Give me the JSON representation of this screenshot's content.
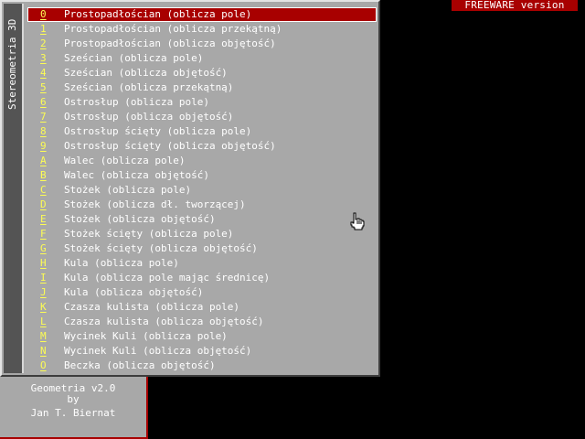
{
  "banner": {
    "text": "FREEWARE version"
  },
  "menu": {
    "title": "Stereometria 3D",
    "selected_index": 0,
    "items": [
      {
        "key": "0",
        "label": "Prostopadłościan (oblicza pole)"
      },
      {
        "key": "1",
        "label": "Prostopadłościan (oblicza przekątną)"
      },
      {
        "key": "2",
        "label": "Prostopadłościan (oblicza objętość)"
      },
      {
        "key": "3",
        "label": "Sześcian (oblicza pole)"
      },
      {
        "key": "4",
        "label": "Sześcian (oblicza objętość)"
      },
      {
        "key": "5",
        "label": "Sześcian (oblicza przekątną)"
      },
      {
        "key": "6",
        "label": "Ostrosłup (oblicza pole)"
      },
      {
        "key": "7",
        "label": "Ostrosłup (oblicza objętość)"
      },
      {
        "key": "8",
        "label": "Ostrosłup ścięty (oblicza pole)"
      },
      {
        "key": "9",
        "label": "Ostrosłup ścięty (oblicza objętość)"
      },
      {
        "key": "A",
        "label": "Walec (oblicza pole)"
      },
      {
        "key": "B",
        "label": "Walec (oblicza objętość)"
      },
      {
        "key": "C",
        "label": "Stożek (oblicza pole)"
      },
      {
        "key": "D",
        "label": "Stożek (oblicza dł. tworzącej)"
      },
      {
        "key": "E",
        "label": "Stożek (oblicza objętość)"
      },
      {
        "key": "F",
        "label": "Stożek ścięty (oblicza pole)"
      },
      {
        "key": "G",
        "label": "Stożek ścięty (oblicza objętość)"
      },
      {
        "key": "H",
        "label": "Kula (oblicza pole)"
      },
      {
        "key": "I",
        "label": "Kula (oblicza pole mając średnicę)"
      },
      {
        "key": "J",
        "label": "Kula (oblicza objętość)"
      },
      {
        "key": "K",
        "label": "Czasza kulista (oblicza pole)"
      },
      {
        "key": "L",
        "label": "Czasza kulista (oblicza objętość)"
      },
      {
        "key": "M",
        "label": "Wycinek Kuli (oblicza pole)"
      },
      {
        "key": "N",
        "label": "Wycinek Kuli (oblicza objętość)"
      },
      {
        "key": "O",
        "label": "Beczka (oblicza objętość)"
      }
    ]
  },
  "credits": {
    "line1": "Geometria v2.0",
    "line2": "by",
    "line3": "Jan T. Biernat"
  },
  "cursor": {
    "icon": "hand-pointer-icon"
  },
  "colors": {
    "background": "#000000",
    "panel": "#a8a8a8",
    "side_strip": "#545454",
    "selection": "#a80000",
    "hotkey": "#fcfc54",
    "text": "#ffffff"
  }
}
